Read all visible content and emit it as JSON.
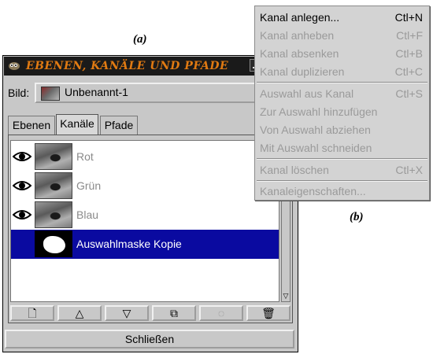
{
  "captions": {
    "a": "(a)",
    "b": "(b)"
  },
  "dialog": {
    "title": "Ebenen, Kanäle und Pfade",
    "image_label": "Bild:",
    "image_value": "Unbenannt-1",
    "dropdown_arrow": "—",
    "tabs": [
      {
        "label": "Ebenen",
        "active": false
      },
      {
        "label": "Kanäle",
        "active": true
      },
      {
        "label": "Pfade",
        "active": false
      }
    ],
    "channels": [
      {
        "name": "Rot",
        "visible": true,
        "selected": false
      },
      {
        "name": "Grün",
        "visible": true,
        "selected": false
      },
      {
        "name": "Blau",
        "visible": true,
        "selected": false
      },
      {
        "name": "Auswahlmaske Kopie",
        "visible": false,
        "selected": true
      }
    ],
    "toolbar": {
      "new": "🗋",
      "raise": "△",
      "lower": "▽",
      "duplicate": "⧉",
      "to_selection": "◌",
      "delete": "🗑"
    },
    "scroll_arrow": "▽",
    "close_label": "Schließen"
  },
  "menu": {
    "items": [
      {
        "label": "Kanal anlegen...",
        "shortcut": "Ctl+N",
        "enabled": true
      },
      {
        "label": "Kanal anheben",
        "shortcut": "Ctl+F",
        "enabled": false
      },
      {
        "label": "Kanal absenken",
        "shortcut": "Ctl+B",
        "enabled": false
      },
      {
        "label": "Kanal duplizieren",
        "shortcut": "Ctl+C",
        "enabled": false
      },
      {
        "label": "Auswahl aus Kanal",
        "shortcut": "Ctl+S",
        "enabled": false
      },
      {
        "label": "Zur Auswahl hinzufügen",
        "shortcut": "",
        "enabled": false
      },
      {
        "label": "Von Auswahl abziehen",
        "shortcut": "",
        "enabled": false
      },
      {
        "label": "Mit Auswahl schneiden",
        "shortcut": "",
        "enabled": false
      },
      {
        "label": "Kanal löschen",
        "shortcut": "Ctl+X",
        "enabled": false
      },
      {
        "label": "Kanaleigenschaften...",
        "shortcut": "",
        "enabled": false
      }
    ]
  },
  "colors": {
    "selection": "#0a0aa0",
    "title_text": "#e07a12",
    "window_bg": "#c8c8c8"
  }
}
